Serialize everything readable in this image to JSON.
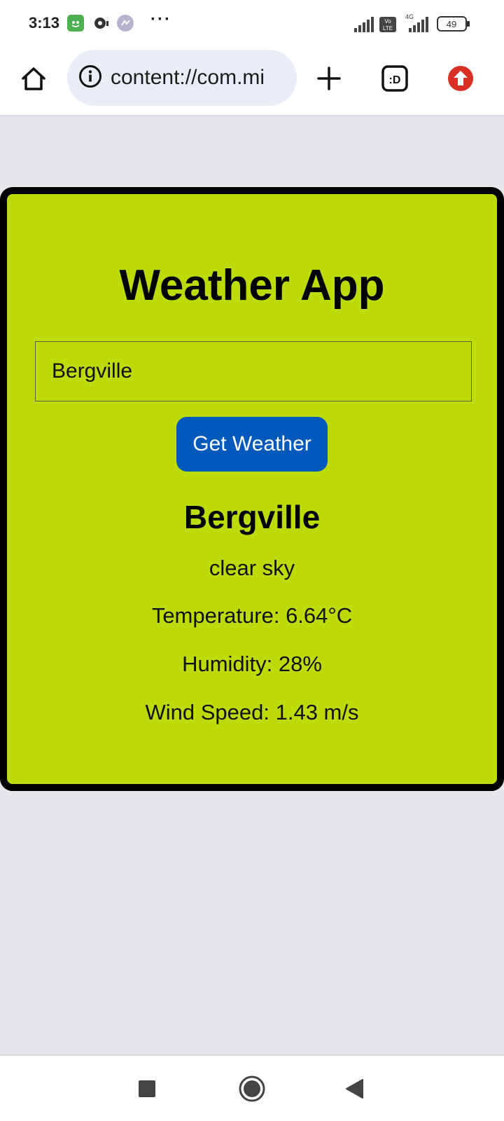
{
  "status_bar": {
    "time": "3:13",
    "battery": "49",
    "network": "4G",
    "volte": "Vo LTE"
  },
  "browser": {
    "url": "content://com.mi",
    "home_icon": "home-icon",
    "info_icon": "info-icon",
    "new_tab_icon": "plus-icon",
    "tabs_label": ":D",
    "update_icon": "arrow-up-icon"
  },
  "app": {
    "title": "Weather App",
    "input_value": "Bergville",
    "button_label": "Get Weather",
    "accent_color": "#bddb09",
    "button_color": "#0059bb"
  },
  "result": {
    "city": "Bergville",
    "description": "clear sky",
    "temperature": "Temperature: 6.64°C",
    "humidity": "Humidity: 28%",
    "wind": "Wind Speed: 1.43 m/s"
  },
  "nav": {
    "recents_icon": "square-icon",
    "home_icon": "circle-home-icon",
    "back_icon": "back-triangle-icon"
  }
}
